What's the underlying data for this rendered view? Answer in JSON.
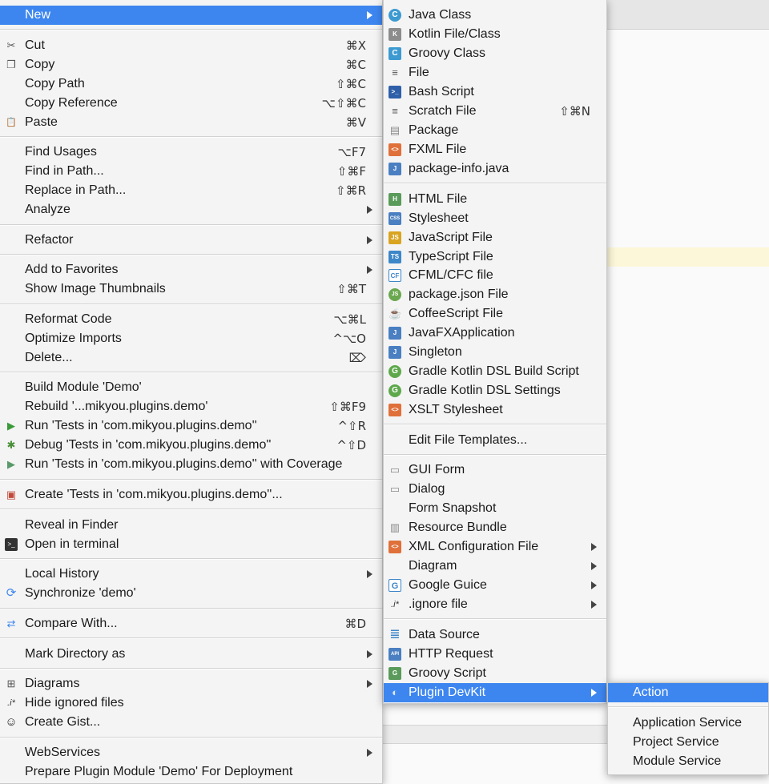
{
  "colors": {
    "highlight": "#3d86f0",
    "menu_bg": "#f4f4f4",
    "separator": "#d2d2d2"
  },
  "context_menu": {
    "new": {
      "label": "New"
    },
    "cut": {
      "label": "Cut",
      "shortcut": "⌘X"
    },
    "copy": {
      "label": "Copy",
      "shortcut": "⌘C"
    },
    "copy_path": {
      "label": "Copy Path",
      "shortcut": "⇧⌘C"
    },
    "copy_reference": {
      "label": "Copy Reference",
      "shortcut": "⌥⇧⌘C"
    },
    "paste": {
      "label": "Paste",
      "shortcut": "⌘V"
    },
    "find_usages": {
      "label": "Find Usages",
      "shortcut": "⌥F7"
    },
    "find_in_path": {
      "label": "Find in Path...",
      "shortcut": "⇧⌘F"
    },
    "replace_in_path": {
      "label": "Replace in Path...",
      "shortcut": "⇧⌘R"
    },
    "analyze": {
      "label": "Analyze"
    },
    "refactor": {
      "label": "Refactor"
    },
    "add_to_favorites": {
      "label": "Add to Favorites"
    },
    "show_image_thumbnails": {
      "label": "Show Image Thumbnails",
      "shortcut": "⇧⌘T"
    },
    "reformat_code": {
      "label": "Reformat Code",
      "shortcut": "⌥⌘L"
    },
    "optimize_imports": {
      "label": "Optimize Imports",
      "shortcut": "^⌥O"
    },
    "delete": {
      "label": "Delete...",
      "shortcut": "⌦"
    },
    "build_module": {
      "label": "Build Module 'Demo'"
    },
    "rebuild": {
      "label": "Rebuild '...mikyou.plugins.demo'",
      "shortcut": "⇧⌘F9"
    },
    "run_tests": {
      "label": "Run 'Tests in 'com.mikyou.plugins.demo''",
      "shortcut": "^⇧R"
    },
    "debug_tests": {
      "label": "Debug 'Tests in 'com.mikyou.plugins.demo''",
      "shortcut": "^⇧D"
    },
    "run_coverage": {
      "label": "Run 'Tests in 'com.mikyou.plugins.demo'' with Coverage"
    },
    "create_tests": {
      "label": "Create 'Tests in 'com.mikyou.plugins.demo''..."
    },
    "reveal_in_finder": {
      "label": "Reveal in Finder"
    },
    "open_in_terminal": {
      "label": "Open in terminal"
    },
    "local_history": {
      "label": "Local History"
    },
    "synchronize": {
      "label": "Synchronize 'demo'"
    },
    "compare_with": {
      "label": "Compare With...",
      "shortcut": "⌘D"
    },
    "mark_directory_as": {
      "label": "Mark Directory as"
    },
    "diagrams": {
      "label": "Diagrams"
    },
    "hide_ignored_files": {
      "label": "Hide ignored files"
    },
    "create_gist": {
      "label": "Create Gist..."
    },
    "webservices": {
      "label": "WebServices"
    },
    "prepare_plugin_module": {
      "label": "Prepare Plugin Module 'Demo' For Deployment"
    }
  },
  "new_menu": {
    "java_class": {
      "label": "Java Class"
    },
    "kotlin_file": {
      "label": "Kotlin File/Class"
    },
    "groovy_class": {
      "label": "Groovy Class"
    },
    "file": {
      "label": "File"
    },
    "bash_script": {
      "label": "Bash Script"
    },
    "scratch_file": {
      "label": "Scratch File",
      "shortcut": "⇧⌘N"
    },
    "package": {
      "label": "Package"
    },
    "fxml_file": {
      "label": "FXML File"
    },
    "package_info": {
      "label": "package-info.java"
    },
    "html_file": {
      "label": "HTML File"
    },
    "stylesheet": {
      "label": "Stylesheet"
    },
    "javascript_file": {
      "label": "JavaScript File"
    },
    "typescript_file": {
      "label": "TypeScript File"
    },
    "cfml_file": {
      "label": "CFML/CFC file"
    },
    "package_json": {
      "label": "package.json File"
    },
    "coffeescript_file": {
      "label": "CoffeeScript File"
    },
    "javafx_app": {
      "label": "JavaFXApplication"
    },
    "singleton": {
      "label": "Singleton"
    },
    "gradle_kotlin_build": {
      "label": "Gradle Kotlin DSL Build Script"
    },
    "gradle_kotlin_settings": {
      "label": "Gradle Kotlin DSL Settings"
    },
    "xslt_stylesheet": {
      "label": "XSLT Stylesheet"
    },
    "edit_file_templates": {
      "label": "Edit File Templates..."
    },
    "gui_form": {
      "label": "GUI Form"
    },
    "dialog": {
      "label": "Dialog"
    },
    "form_snapshot": {
      "label": "Form Snapshot"
    },
    "resource_bundle": {
      "label": "Resource Bundle"
    },
    "xml_configuration": {
      "label": "XML Configuration File"
    },
    "diagram": {
      "label": "Diagram"
    },
    "google_guice": {
      "label": "Google Guice"
    },
    "ignore_file": {
      "label": ".ignore file"
    },
    "data_source": {
      "label": "Data Source"
    },
    "http_request": {
      "label": "HTTP Request"
    },
    "groovy_script": {
      "label": "Groovy Script"
    },
    "plugin_devkit": {
      "label": "Plugin DevKit"
    }
  },
  "devkit_menu": {
    "action": {
      "label": "Action"
    },
    "application_service": {
      "label": "Application Service"
    },
    "project_service": {
      "label": "Project Service"
    },
    "module_service": {
      "label": "Module Service"
    }
  },
  "icon_glyphs": {
    "cut": "✂",
    "copy": "❐",
    "paste": "📋",
    "run": "▶",
    "debug": "✱",
    "coverage": "▶",
    "create": "▣",
    "terminal": ">_",
    "sync": "⟳",
    "compare": "⇄",
    "diagrams": "⊞",
    "ignore": ".i*",
    "gist": "☺",
    "java": "C",
    "kotlin": "K",
    "groovy": "C",
    "file": "≡",
    "bash": ">_",
    "scratch": "≡",
    "package": "▤",
    "fxml": "<>",
    "info": "J",
    "html": "H",
    "css": "CSS",
    "js": "JS",
    "ts": "TS",
    "cf": "CF",
    "json": "JS",
    "coffee": "☕",
    "javafx": "J",
    "singleton": "J",
    "gradle": "G",
    "xslt": "<>",
    "form": "▭",
    "bundle": "▥",
    "xml": "<>",
    "guice": "G",
    "dotignore": ".i*",
    "db": "≣",
    "api": "API",
    "groovyscript": "G",
    "devkit": "◐"
  }
}
